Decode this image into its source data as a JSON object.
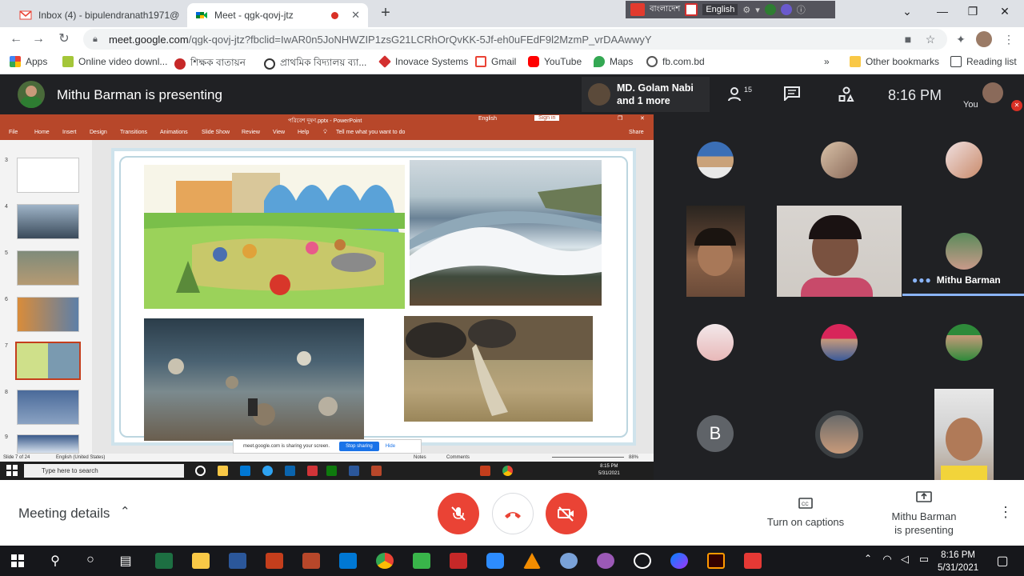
{
  "browser": {
    "tabs": [
      {
        "label": "Inbox (4) - bipulendranath1971@",
        "close": "✕"
      },
      {
        "label": "Meet - qgk-qovj-jtz",
        "close": "✕"
      }
    ],
    "new_tab": "+",
    "extension_bar_text": "English",
    "extension_brand": "বাংলাদেশ",
    "address": {
      "host": "meet.google.com",
      "path": "/qgk-qovj-jtz?fbclid=IwAR0n5JoNHWZIP1zsG21LCRhOrQvKK-5Jf-eh0uFEdF9l2MzmP_vrDAAwwyY"
    },
    "bookmarks": [
      {
        "label": "Apps",
        "color": "#4285f4"
      },
      {
        "label": "Online video downl...",
        "color": "#a4c639"
      },
      {
        "label": "শিক্ষক বাতায়ন",
        "color": "#c62828"
      },
      {
        "label": "প্রাথমিক বিদ্যালয় ব্যা...",
        "color": "#333333"
      },
      {
        "label": "Inovace Systems",
        "color": "#d32f2f"
      },
      {
        "label": "Gmail",
        "color": "#ea4335"
      },
      {
        "label": "YouTube",
        "color": "#ff0000"
      },
      {
        "label": "Maps",
        "color": "#34a853"
      },
      {
        "label": "fb.com.bd",
        "color": "#555555"
      }
    ],
    "bookmarks_more": "»",
    "other_bookmarks": "Other bookmarks",
    "reading_list": "Reading list"
  },
  "meet": {
    "presenting_title": "Mithu Barman is presenting",
    "speaker": {
      "line1": "MD. Golam Nabi",
      "line2": "and 1 more"
    },
    "participant_count": "15",
    "time": "8:16 PM",
    "you_label": "You",
    "pinned_name": "Mithu Barman",
    "avatar_initial": "B"
  },
  "shared_screen": {
    "ppt_title": "পরিবেশ দূষণ.pptx - PowerPoint",
    "ppt_english": "English",
    "sign_in": "Sign in",
    "ribbon_tabs": [
      "File",
      "Home",
      "Insert",
      "Design",
      "Transitions",
      "Animations",
      "Slide Show",
      "Review",
      "View",
      "Help"
    ],
    "tell_me": "Tell me what you want to do",
    "share": "Share",
    "slide_numbers": [
      "3",
      "4",
      "5",
      "6",
      "7",
      "8",
      "9"
    ],
    "status_left": "Slide 7 of 24",
    "status_lang": "English (United States)",
    "status_notes": "Notes",
    "status_comments": "Comments",
    "zoom": "88%",
    "share_notice": "meet.google.com is sharing your screen.",
    "stop_sharing": "Stop sharing",
    "hide": "Hide",
    "inner_search": "Type here to search",
    "inner_time": "8:15 PM",
    "inner_date": "5/31/2021"
  },
  "controls": {
    "meeting_details": "Meeting details",
    "captions": "Turn on captions",
    "presenting_line1": "Mithu Barman",
    "presenting_line2": "is presenting"
  },
  "taskbar": {
    "time": "8:16 PM",
    "date": "5/31/2021"
  }
}
